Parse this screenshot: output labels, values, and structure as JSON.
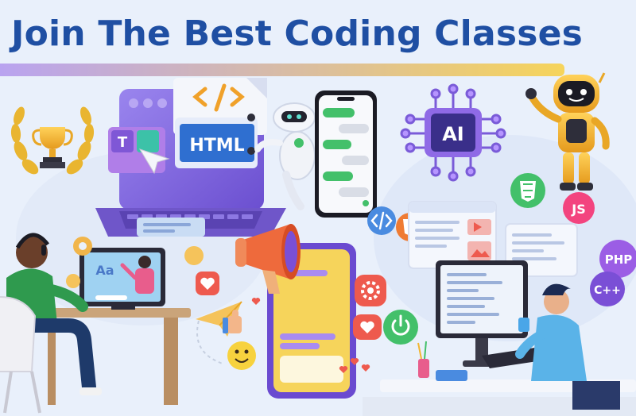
{
  "banner": {
    "headline": "Join The Best Coding Classes"
  },
  "colors": {
    "headline": "#1f4fa3",
    "bar_start": "#b9a3f0",
    "bar_end": "#f6d45b",
    "background": "#e9f0fb",
    "laptop": "#7d62d8",
    "phone_dark": "#1b1b24",
    "accent_green": "#43c06a",
    "accent_red": "#ee5a4e",
    "accent_purple": "#9b5de5",
    "gold": "#f2b632"
  },
  "icons": [
    "trophy-icon",
    "laurel-wreath-icon",
    "code-brackets-icon",
    "chatbot-robot-icon",
    "ai-chip-icon",
    "waving-robot-icon",
    "html5-icon",
    "css3-icon",
    "javascript-icon",
    "php-icon",
    "cplusplus-icon",
    "megaphone-icon",
    "gear-icon",
    "heart-icon",
    "thumbs-up-icon",
    "smiley-icon",
    "paper-plane-icon",
    "power-icon",
    "code-tag-icon"
  ],
  "labels": {
    "laptop_tag": "HTML",
    "text_tool": "T",
    "video_lesson": "Aa",
    "chip": "AI",
    "js_badge": "JS",
    "php_badge": "PHP",
    "cpp_badge": "C++"
  }
}
